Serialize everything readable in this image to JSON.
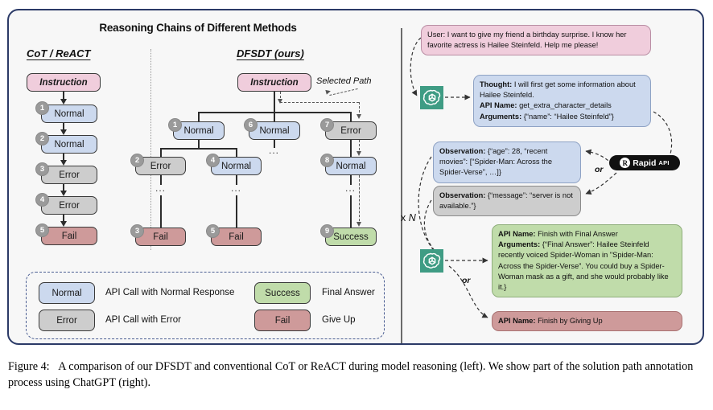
{
  "figure": {
    "panel_title": "Reasoning Chains of Different Methods",
    "caption_label": "Figure 4:",
    "caption_text": "A comparison of our DFSDT and conventional CoT or ReACT during model reasoning (left). We show part of the solution path annotation process using ChatGPT (right)."
  },
  "left": {
    "cot_heading": "CoT / ReACT",
    "dfsdt_heading": "DFSDT (ours)",
    "selected_path_label": "Selected Path",
    "ellipsis": "...",
    "cot_chain": [
      {
        "label": "Instruction",
        "badge": ""
      },
      {
        "label": "Normal",
        "badge": "1"
      },
      {
        "label": "Normal",
        "badge": "2"
      },
      {
        "label": "Error",
        "badge": "3"
      },
      {
        "label": "Error",
        "badge": "4"
      },
      {
        "label": "Fail",
        "badge": "5"
      }
    ],
    "dfsdt_nodes": {
      "root": {
        "label": "Instruction",
        "badge": ""
      },
      "n1": {
        "label": "Normal",
        "badge": "1"
      },
      "n6": {
        "label": "Normal",
        "badge": "6"
      },
      "n7": {
        "label": "Error",
        "badge": "7"
      },
      "n2": {
        "label": "Error",
        "badge": "2"
      },
      "n4": {
        "label": "Normal",
        "badge": "4"
      },
      "n8": {
        "label": "Normal",
        "badge": "8"
      },
      "n3": {
        "label": "Fail",
        "badge": "3"
      },
      "n5": {
        "label": "Fail",
        "badge": "5"
      },
      "n9": {
        "label": "Success",
        "badge": "9"
      }
    }
  },
  "legend": {
    "items": [
      {
        "box": "Normal",
        "desc": "API Call with Normal Response"
      },
      {
        "box": "Success",
        "desc": "Final Answer"
      },
      {
        "box": "Error",
        "desc": "API Call with Error"
      },
      {
        "box": "Fail",
        "desc": "Give Up"
      }
    ]
  },
  "right": {
    "user_bubble": "User: I want to give my friend a birthday surprise. I know her favorite actress is Hailee Steinfeld. Help me please!",
    "thought_bubble": {
      "thought_key": "Thought:",
      "thought_val": " I will first get some information about Hailee Steinfeld.",
      "api_key": "API Name:",
      "api_val": " get_extra_character_details",
      "args_key": "Arguments:",
      "args_val": " {“name”: “Hailee Steinfeld”}"
    },
    "observation_ok": {
      "key": "Observation:",
      "val": " {“age”: 28, “recent movies”: [“Spider-Man: Across the Spider-Verse”, …]}"
    },
    "observation_error": {
      "key": "Observation:",
      "val": " {“message”: “server is not available.”}"
    },
    "final_answer": {
      "api_key": "API Name:",
      "api_val": "  Finish with Final Answer",
      "args_key": "Arguments:",
      "args_val": " {“Final Answer”: Hailee Steinfeld recently voiced Spider-Woman in \"Spider-Man: Across the Spider-Verse”.  You could buy a Spider-Woman mask as a gift, and she would probably like it.}"
    },
    "give_up": {
      "api_key": "API Name:",
      "api_val": "  Finish by Giving Up"
    },
    "rapidapi": {
      "mark": "R",
      "name": "Rapid",
      "suffix": "API"
    },
    "or_label": "or",
    "loop_label_x": "x",
    "loop_label_n": "N"
  },
  "colors": {
    "normal": "#ccd9ee",
    "error": "#cdcdcd",
    "fail": "#ce9a9a",
    "success": "#c0dcaa",
    "instruction": "#f0cddc",
    "frame_border": "#2b3a67",
    "legend_border": "#4a5d92",
    "gpt_green": "#3f9c84",
    "rapidapi_black": "#111111"
  }
}
